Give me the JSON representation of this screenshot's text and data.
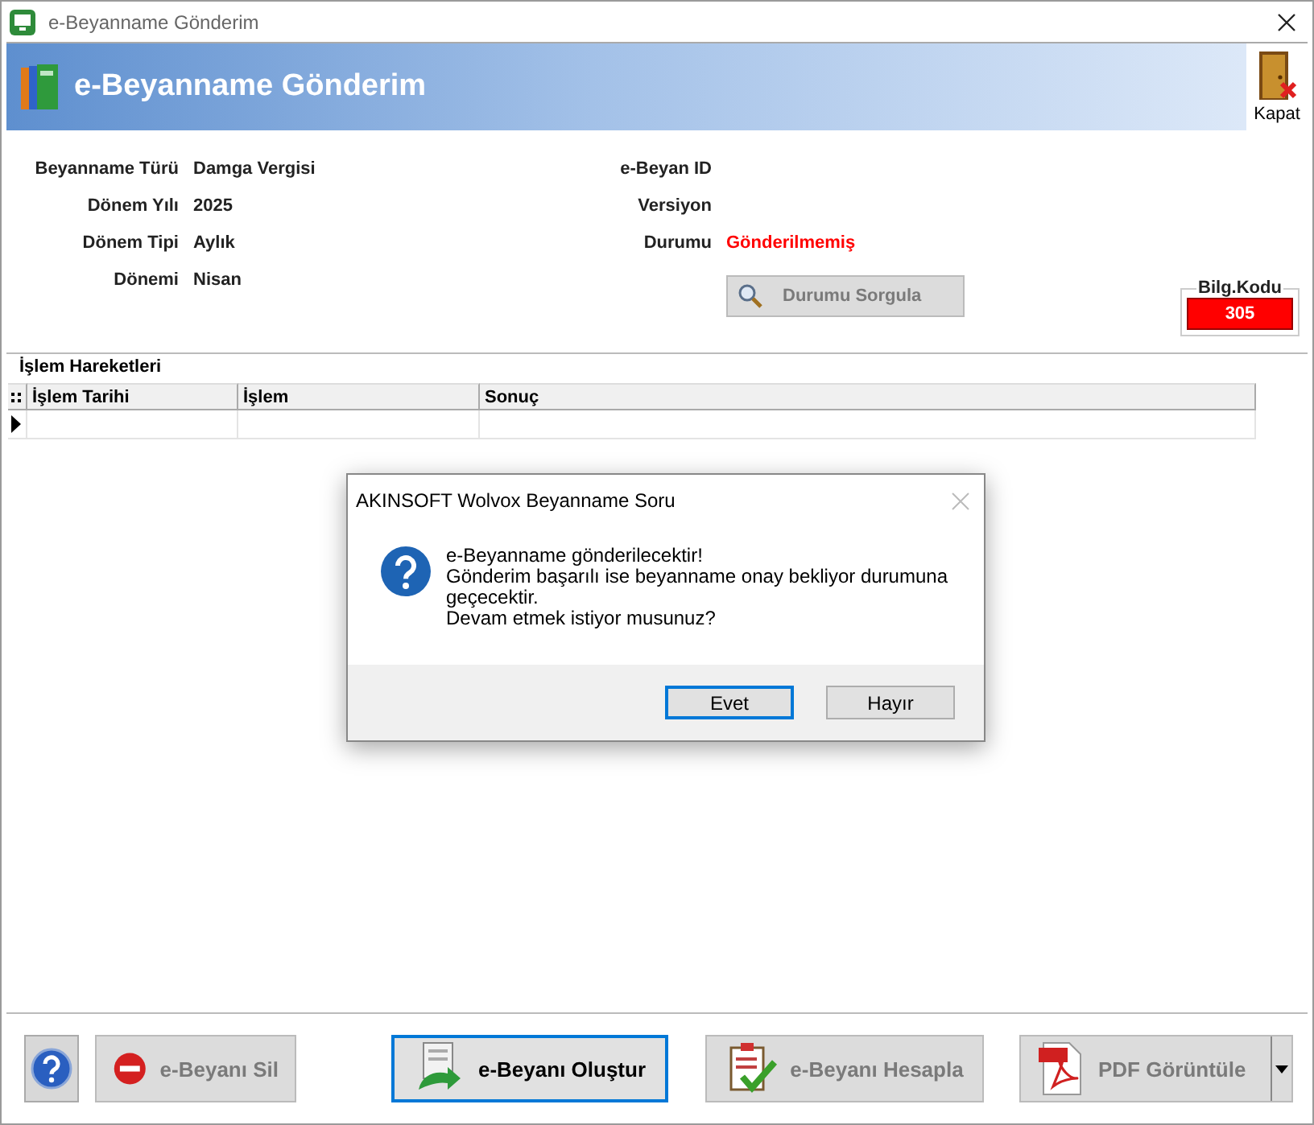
{
  "window": {
    "title": "e-Beyanname Gönderim"
  },
  "header": {
    "title": "e-Beyanname Gönderim",
    "close_label": "Kapat"
  },
  "fields_left": [
    {
      "label": "Beyanname Türü",
      "value": "Damga Vergisi"
    },
    {
      "label": "Dönem Yılı",
      "value": "2025"
    },
    {
      "label": "Dönem Tipi",
      "value": "Aylık"
    },
    {
      "label": "Dönemi",
      "value": "Nisan"
    }
  ],
  "fields_right": [
    {
      "label": "e-Beyan ID",
      "kind": "plain"
    },
    {
      "label": "Versiyon",
      "kind": "plain"
    },
    {
      "label": "Durumu",
      "value": "Gönderilmemiş",
      "kind": "status"
    }
  ],
  "query_button": {
    "label": "Durumu Sorgula",
    "disabled": true
  },
  "bilg_kodu": {
    "label": "Bilg.Kodu",
    "value": "305"
  },
  "transactions": {
    "title": "İşlem Hareketleri",
    "columns": [
      "İşlem Tarihi",
      "İşlem",
      "Sonuç"
    ]
  },
  "dialog": {
    "title": "AKINSOFT Wolvox Beyanname Soru",
    "message_lines": [
      "e-Beyanname gönderilecektir!",
      "Gönderim başarılı ise beyanname onay bekliyor durumuna geçecektir.",
      "Devam etmek istiyor musunuz?"
    ],
    "buttons": [
      {
        "label": "Evet",
        "selected": true
      },
      {
        "label": "Hayır",
        "selected": false
      }
    ]
  },
  "toolbar": [
    {
      "kind": "help"
    },
    {
      "kind": "delete",
      "label": "e-Beyanı Sil",
      "disabled": true
    },
    {
      "kind": "create",
      "label": "e-Beyanı Oluştur",
      "disabled": false
    },
    {
      "kind": "calculate",
      "label": "e-Beyanı Hesapla",
      "disabled": true
    },
    {
      "kind": "pdf",
      "label": "PDF Görüntüle",
      "disabled": true
    }
  ]
}
